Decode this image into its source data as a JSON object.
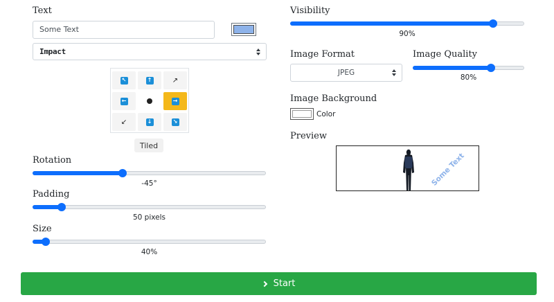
{
  "text_section": {
    "label": "Text",
    "input_value": "Some Text",
    "swatch_color": "#8eb3ea"
  },
  "font_select": {
    "value": "Impact"
  },
  "position_grid": {
    "selected": "right",
    "cells": [
      "top-left",
      "top",
      "top-right",
      "left",
      "center",
      "right",
      "bottom-left",
      "bottom",
      "bottom-right"
    ]
  },
  "tiled_label": "Tiled",
  "rotation": {
    "label": "Rotation",
    "value_text": "-45°",
    "fraction": 0.38
  },
  "padding": {
    "label": "Padding",
    "value_text": "50 pixels",
    "fraction": 0.11
  },
  "size": {
    "label": "Size",
    "value_text": "40%",
    "fraction": 0.04
  },
  "visibility": {
    "label": "Visibility",
    "value_text": "90%",
    "fraction": 0.88
  },
  "image_format": {
    "label": "Image Format",
    "value": "JPEG"
  },
  "image_quality": {
    "label": "Image Quality",
    "value_text": "80%",
    "fraction": 0.72
  },
  "image_background": {
    "label": "Image Background",
    "button_label": "Color"
  },
  "preview": {
    "label": "Preview",
    "watermark_text": "Some Text",
    "watermark_color": "#8eb3ea"
  },
  "start_button": {
    "label": "Start"
  },
  "colors": {
    "accent": "#0d6efd",
    "success": "#28a745",
    "active_cell": "#f4b81a",
    "arrow_icon": "#1b8fd8"
  }
}
